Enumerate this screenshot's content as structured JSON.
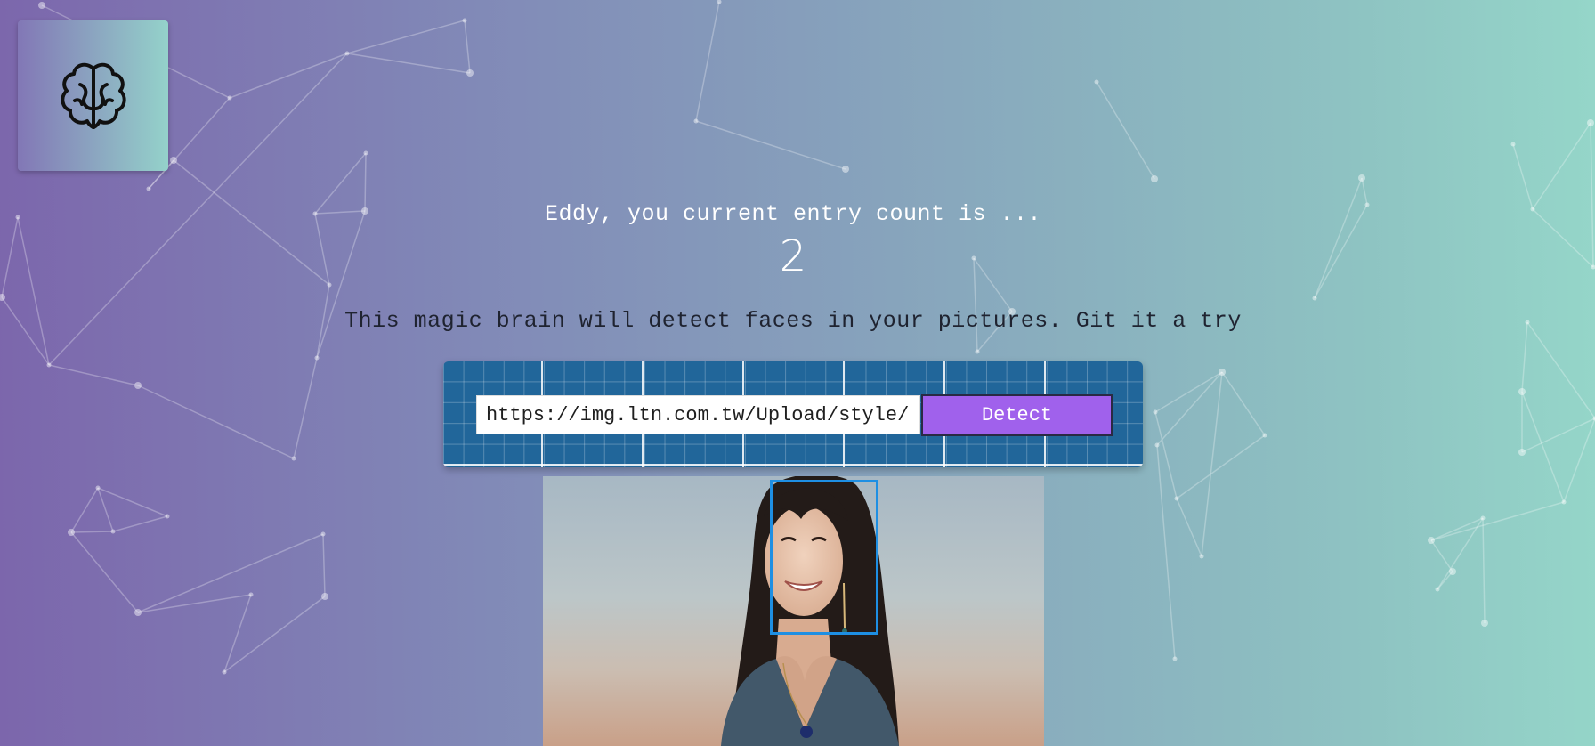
{
  "app": {
    "logo_icon": "brain-icon"
  },
  "header": {
    "greeting": "Eddy, you current entry count is ...",
    "entry_count": "2"
  },
  "main": {
    "tagline": "This magic brain will detect faces in your pictures. Git it a try",
    "image_url_value": "https://img.ltn.com.tw/Upload/style/",
    "detect_label": "Detect"
  },
  "colors": {
    "accent_button": "#a061ec",
    "form_panel": "#21669a",
    "face_box_border": "#1e8fe3",
    "gradient_start": "#7c66ac",
    "gradient_end": "#95d6c9"
  }
}
